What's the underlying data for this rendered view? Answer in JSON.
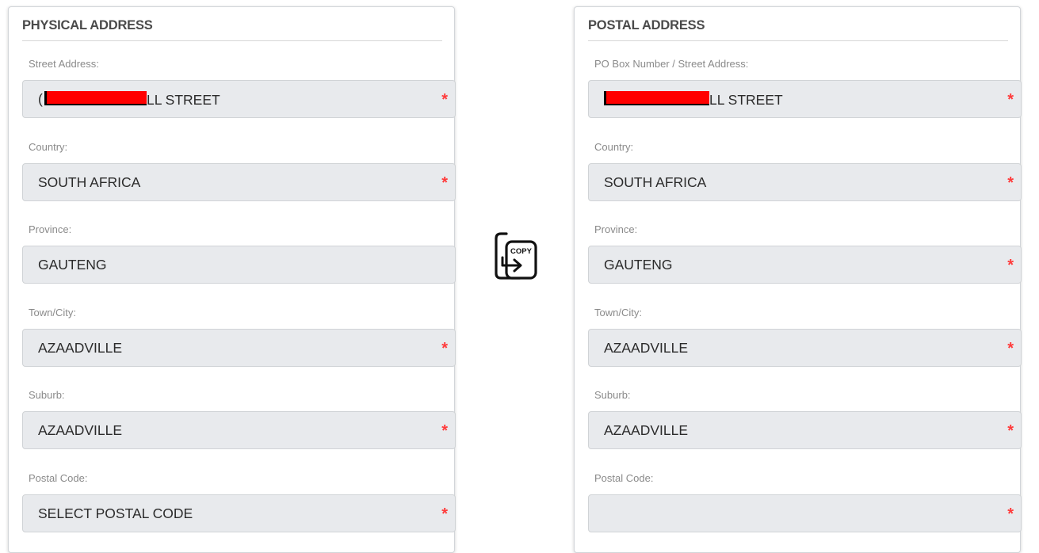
{
  "physical": {
    "title": "PHYSICAL ADDRESS",
    "street_label": "Street Address:",
    "street_prefix": "(",
    "street_suffix": "LL STREET",
    "country_label": "Country:",
    "country_value": "SOUTH AFRICA",
    "province_label": "Province:",
    "province_value": "GAUTENG",
    "town_label": "Town/City:",
    "town_value": "AZAADVILLE",
    "suburb_label": "Suburb:",
    "suburb_value": "AZAADVILLE",
    "postal_label": "Postal Code:",
    "postal_value": "SELECT POSTAL CODE"
  },
  "postal": {
    "title": "POSTAL ADDRESS",
    "street_label": "PO Box Number / Street Address:",
    "street_suffix": "LL STREET",
    "country_label": "Country:",
    "country_value": "SOUTH AFRICA",
    "province_label": "Province:",
    "province_value": "GAUTENG",
    "town_label": "Town/City:",
    "town_value": "AZAADVILLE",
    "suburb_label": "Suburb:",
    "suburb_value": "AZAADVILLE",
    "postal_label": "Postal Code:",
    "postal_value": ""
  },
  "required_marker": "*",
  "copy_label": "COPY",
  "colors": {
    "required": "#ff3b3b",
    "field_bg": "#e8eaed",
    "redaction": "#ff0000"
  }
}
